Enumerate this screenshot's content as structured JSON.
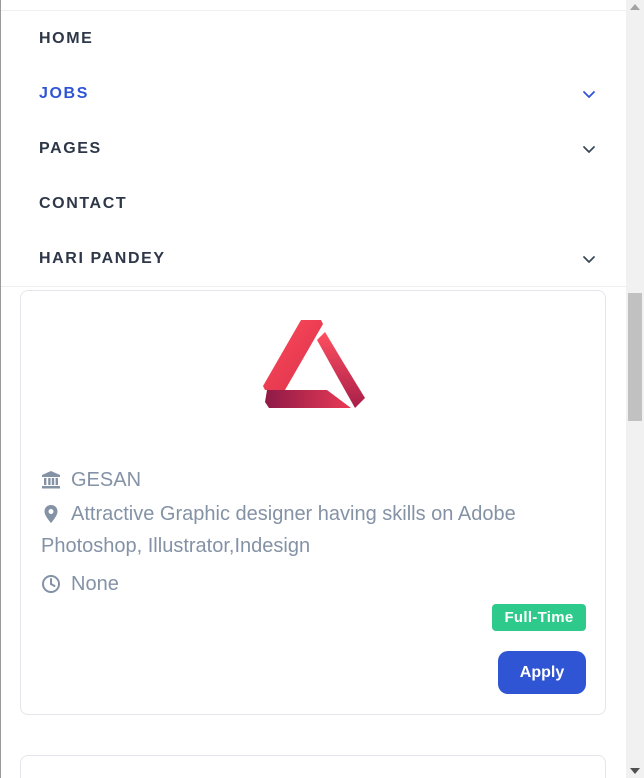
{
  "nav": {
    "items": [
      {
        "label": "HOME",
        "has_dropdown": false,
        "active": false
      },
      {
        "label": "JOBS",
        "has_dropdown": true,
        "active": true
      },
      {
        "label": "PAGES",
        "has_dropdown": true,
        "active": false
      },
      {
        "label": "CONTACT",
        "has_dropdown": false,
        "active": false
      },
      {
        "label": "HARI PANDEY",
        "has_dropdown": true,
        "active": false
      }
    ],
    "colors": {
      "default": "#2d3748",
      "active": "#2f55d4"
    }
  },
  "job_card": {
    "logo_icon": "triangle-logo",
    "company_icon": "bank-icon",
    "company": "GESAN",
    "location_icon": "map-pin-icon",
    "description": "Attractive Graphic designer having skills on Adobe Photoshop, Illustrator,Indesign",
    "time_icon": "clock-icon",
    "time": "None",
    "badge": "Full-Time",
    "apply_label": "Apply",
    "colors": {
      "badge": "#2eca8b",
      "button": "#2f55d4",
      "text": "#8492a6"
    }
  }
}
